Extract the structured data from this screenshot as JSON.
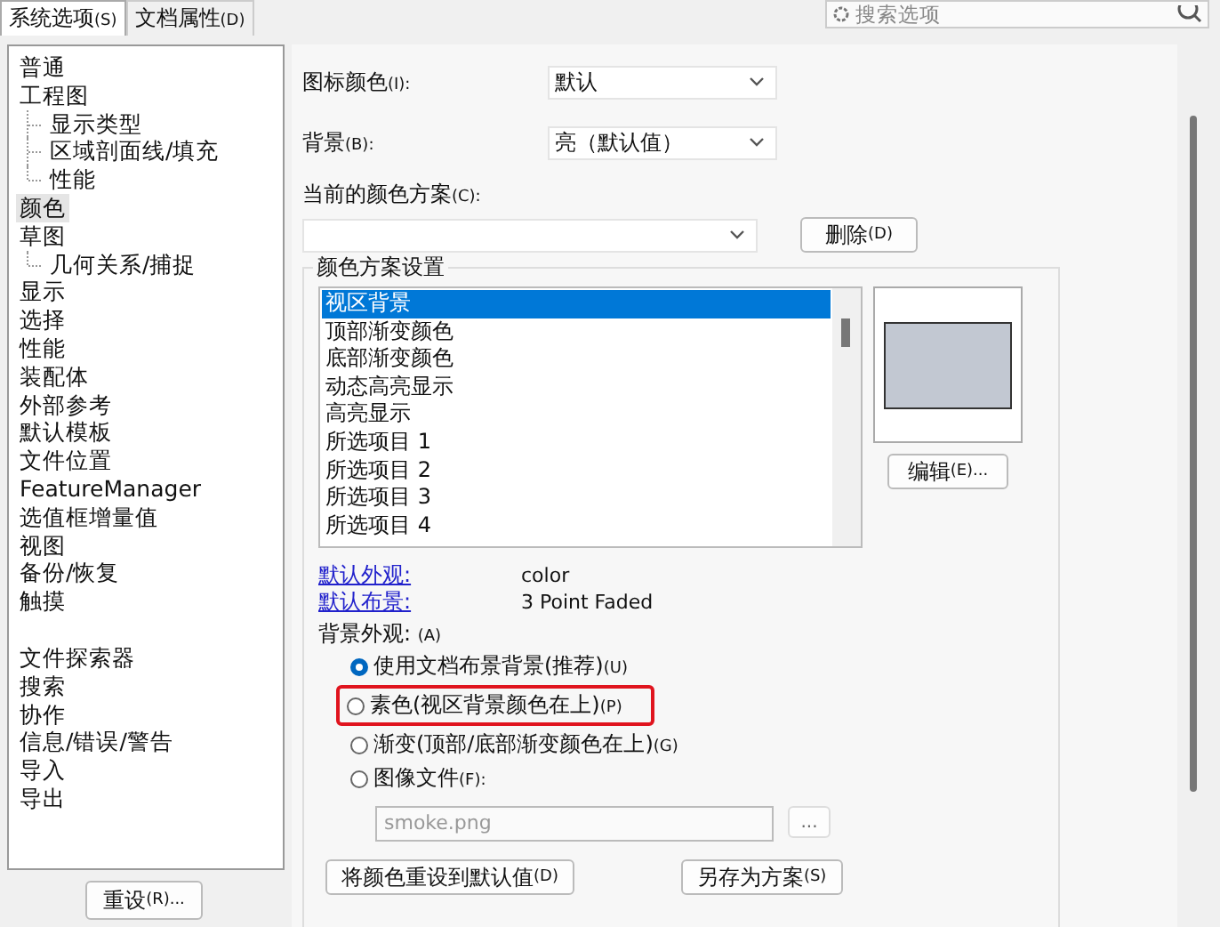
{
  "tabs": [
    {
      "label": "系统选项",
      "accel": "(S)",
      "selected": true
    },
    {
      "label": "文档属性",
      "accel": "(D)",
      "selected": false
    }
  ],
  "search": {
    "placeholder": "搜索选项"
  },
  "tree": [
    {
      "label": "普通",
      "selected": false
    },
    {
      "label": "工程图",
      "selected": false,
      "children": [
        {
          "label": "显示类型",
          "selected": false
        },
        {
          "label": "区域剖面线/填充",
          "selected": false
        },
        {
          "label": "性能",
          "selected": false
        }
      ]
    },
    {
      "label": "颜色",
      "selected": true
    },
    {
      "label": "草图",
      "selected": false,
      "children": [
        {
          "label": "几何关系/捕捉",
          "selected": false
        }
      ]
    },
    {
      "label": "显示",
      "selected": false
    },
    {
      "label": "选择",
      "selected": false
    },
    {
      "label": "性能",
      "selected": false
    },
    {
      "label": "装配体",
      "selected": false
    },
    {
      "label": "外部参考",
      "selected": false
    },
    {
      "label": "默认模板",
      "selected": false
    },
    {
      "label": "文件位置",
      "selected": false
    },
    {
      "label": "FeatureManager",
      "selected": false
    },
    {
      "label": "选值框增量值",
      "selected": false
    },
    {
      "label": "视图",
      "selected": false
    },
    {
      "label": "备份/恢复",
      "selected": false
    },
    {
      "label": "触摸",
      "selected": false
    },
    {
      "kind": "gap"
    },
    {
      "label": "文件探索器",
      "selected": false
    },
    {
      "label": "搜索",
      "selected": false
    },
    {
      "label": "协作",
      "selected": false
    },
    {
      "label": "信息/错误/警告",
      "selected": false
    },
    {
      "label": "导入",
      "selected": false
    },
    {
      "label": "导出",
      "selected": false
    }
  ],
  "reset_button": {
    "label": "重设",
    "accel": "(R)..."
  },
  "icon_color": {
    "label": "图标颜色",
    "accel": "(I):",
    "value": "默认"
  },
  "background": {
    "label": "背景",
    "accel": "(B):",
    "value": "亮（默认值）"
  },
  "current_scheme": {
    "label": "当前的颜色方案",
    "accel": "(C):"
  },
  "delete_button": {
    "label": "删除",
    "accel": "(D)"
  },
  "scheme_settings": {
    "title": "颜色方案设置",
    "items": [
      {
        "label": "视区背景",
        "selected": true
      },
      {
        "label": "顶部渐变颜色",
        "selected": false
      },
      {
        "label": "底部渐变颜色",
        "selected": false
      },
      {
        "label": "动态高亮显示",
        "selected": false
      },
      {
        "label": "高亮显示",
        "selected": false
      },
      {
        "label": "所选项目 1",
        "selected": false
      },
      {
        "label": "所选项目 2",
        "selected": false
      },
      {
        "label": "所选项目 3",
        "selected": false
      },
      {
        "label": "所选项目 4",
        "selected": false
      }
    ],
    "edit_button": {
      "label": "编辑",
      "accel": "(E)..."
    },
    "links": [
      {
        "label": "默认外观:",
        "value": "color"
      },
      {
        "label": "默认布景:",
        "value": "3 Point Faded"
      }
    ],
    "appearance_label": {
      "label": "背景外观:",
      "accel": "(A)"
    },
    "options": [
      {
        "label": "使用文档布景背景(推荐)",
        "accel": "(U)",
        "selected": true,
        "highlighted": false
      },
      {
        "label": "素色(视区背景颜色在上)",
        "accel": "(P)",
        "selected": false,
        "highlighted": true
      },
      {
        "label": "渐变(顶部/底部渐变颜色在上)",
        "accel": "(G)",
        "selected": false,
        "highlighted": false
      },
      {
        "label": "图像文件",
        "accel": "(F):",
        "selected": false,
        "highlighted": false
      }
    ],
    "image_file": {
      "value": "smoke.png",
      "disabled": true,
      "browse": "..."
    },
    "buttons": [
      {
        "label": "将颜色重设到默认值",
        "accel": "(D)"
      },
      {
        "label": "另存为方案",
        "accel": "(S)"
      }
    ]
  }
}
